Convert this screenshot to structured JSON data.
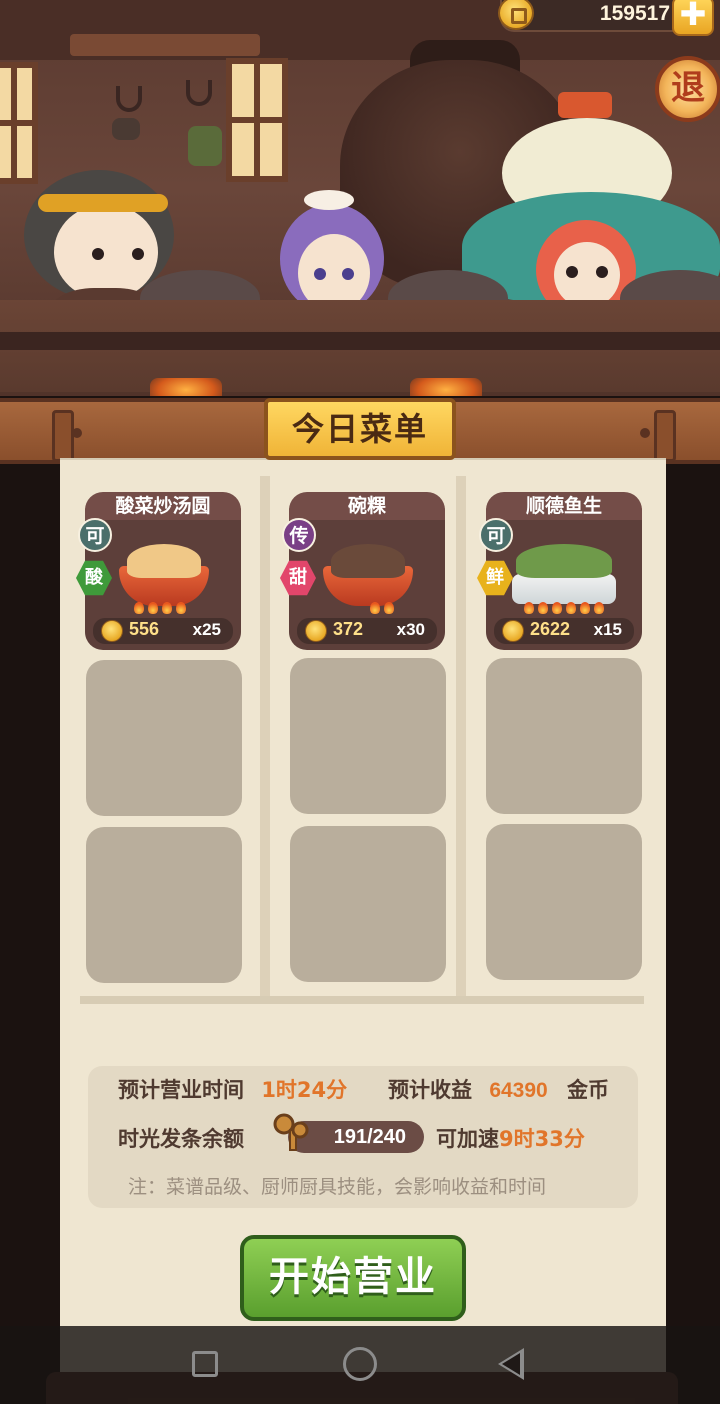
{
  "hud": {
    "coins": "159517",
    "plus_label": "✚",
    "exit_label": "退"
  },
  "menu": {
    "title": "今日菜单",
    "dishes": [
      {
        "name": "酸菜炒汤圆",
        "tags": [
          "可",
          "酸"
        ],
        "price": "556",
        "qty": "x25",
        "tag_colors": [
          "#4b6f6b",
          "#3f9a3a"
        ]
      },
      {
        "name": "碗粿",
        "tags": [
          "传",
          "甜"
        ],
        "price": "372",
        "qty": "x30",
        "tag_colors": [
          "#7a3f86",
          "#e2466b"
        ]
      },
      {
        "name": "顺德鱼生",
        "tags": [
          "可",
          "鲜"
        ],
        "price": "2622",
        "qty": "x15",
        "tag_colors": [
          "#4b6f6b",
          "#e8b21c"
        ]
      }
    ]
  },
  "info": {
    "time_label": "预计营业时间",
    "time_value": "1时24分",
    "income_label": "预计收益",
    "income_value": "64390",
    "income_unit": "金币",
    "scroll_label": "时光发条余额",
    "scroll_value": "191/240",
    "speedup_label": "可加速",
    "speedup_value": "9时33分",
    "note": "注：菜谱品级、厨师厨具技能，会影响收益和时间"
  },
  "start_button": "开始营业"
}
